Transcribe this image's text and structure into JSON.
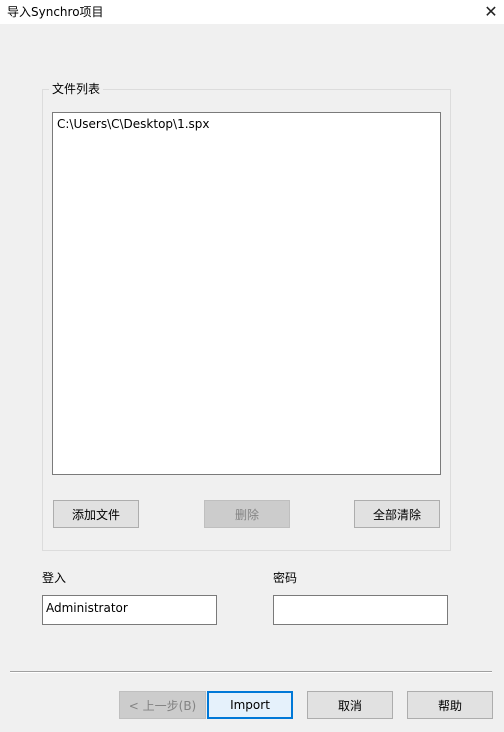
{
  "window": {
    "title": "导入Synchro项目",
    "close_glyph": "✕"
  },
  "file_list": {
    "legend": "文件列表",
    "items": [
      "C:\\Users\\C\\Desktop\\1.spx"
    ],
    "add_label": "添加文件",
    "delete_label": "删除",
    "clear_all_label": "全部清除"
  },
  "login": {
    "label": "登入",
    "value": "Administrator"
  },
  "password": {
    "label": "密码",
    "value": ""
  },
  "footer": {
    "back_label": "< 上一步(B)",
    "import_label": "Import",
    "cancel_label": "取消",
    "help_label": "帮助"
  },
  "colors": {
    "accent": "#0078d7",
    "background": "#f0f0f0"
  },
  "icons": {
    "close": "close-icon"
  }
}
